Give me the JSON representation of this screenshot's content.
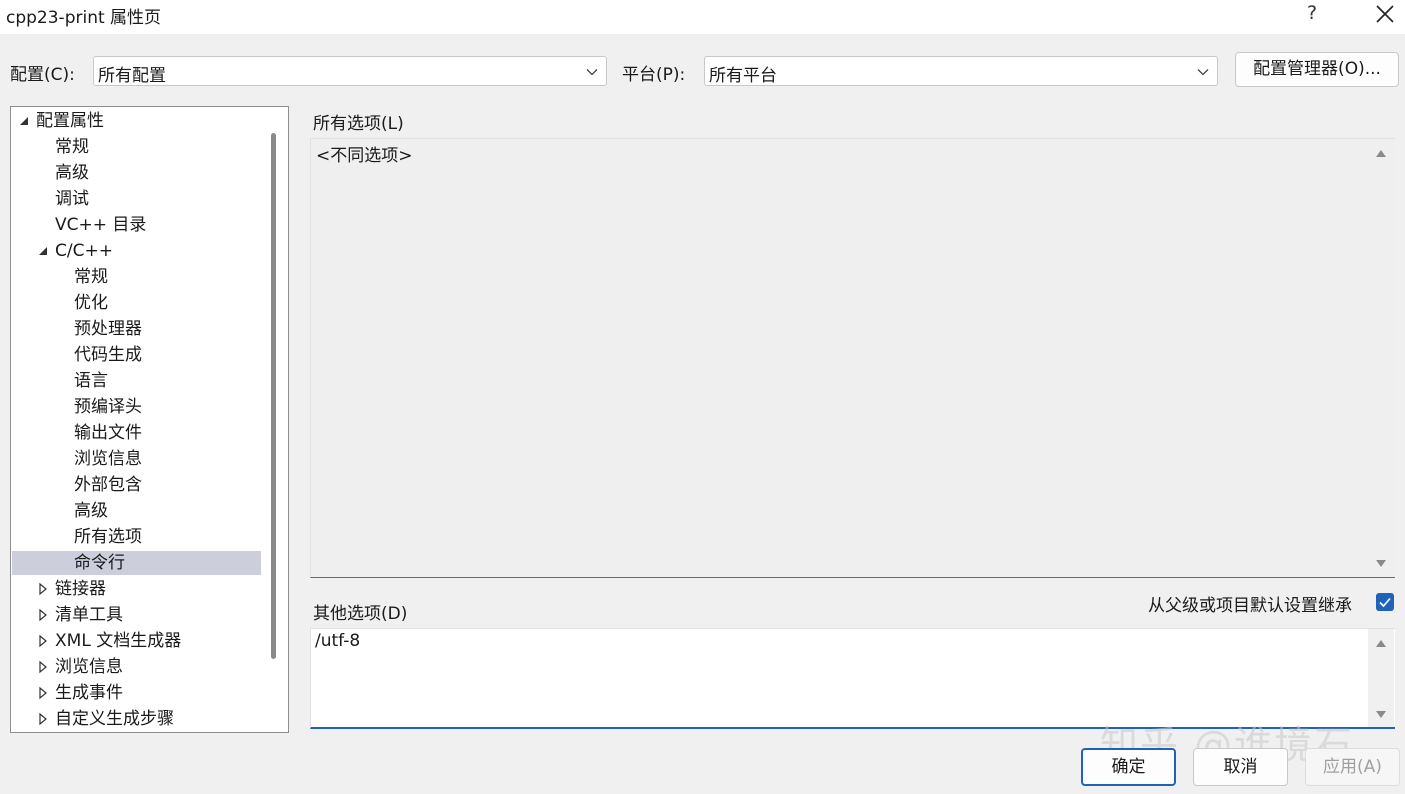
{
  "window": {
    "title": "cpp23-print 属性页",
    "help": "?"
  },
  "config_row": {
    "config_label": "配置(C):",
    "config_value": "所有配置",
    "platform_label": "平台(P):",
    "platform_value": "所有平台",
    "manager_button": "配置管理器(O)..."
  },
  "tree": [
    {
      "label": "配置属性",
      "level": 0,
      "expander": "expanded"
    },
    {
      "label": "常规",
      "level": 1,
      "expander": "none"
    },
    {
      "label": "高级",
      "level": 1,
      "expander": "none"
    },
    {
      "label": "调试",
      "level": 1,
      "expander": "none"
    },
    {
      "label": "VC++ 目录",
      "level": 1,
      "expander": "none"
    },
    {
      "label": "C/C++",
      "level": 1,
      "expander": "expanded"
    },
    {
      "label": "常规",
      "level": 2,
      "expander": "none"
    },
    {
      "label": "优化",
      "level": 2,
      "expander": "none"
    },
    {
      "label": "预处理器",
      "level": 2,
      "expander": "none"
    },
    {
      "label": "代码生成",
      "level": 2,
      "expander": "none"
    },
    {
      "label": "语言",
      "level": 2,
      "expander": "none"
    },
    {
      "label": "预编译头",
      "level": 2,
      "expander": "none"
    },
    {
      "label": "输出文件",
      "level": 2,
      "expander": "none"
    },
    {
      "label": "浏览信息",
      "level": 2,
      "expander": "none"
    },
    {
      "label": "外部包含",
      "level": 2,
      "expander": "none"
    },
    {
      "label": "高级",
      "level": 2,
      "expander": "none"
    },
    {
      "label": "所有选项",
      "level": 2,
      "expander": "none"
    },
    {
      "label": "命令行",
      "level": 2,
      "expander": "none",
      "selected": true
    },
    {
      "label": "链接器",
      "level": 1,
      "expander": "collapsed"
    },
    {
      "label": "清单工具",
      "level": 1,
      "expander": "collapsed"
    },
    {
      "label": "XML 文档生成器",
      "level": 1,
      "expander": "collapsed"
    },
    {
      "label": "浏览信息",
      "level": 1,
      "expander": "collapsed"
    },
    {
      "label": "生成事件",
      "level": 1,
      "expander": "collapsed"
    },
    {
      "label": "自定义生成步骤",
      "level": 1,
      "expander": "collapsed"
    }
  ],
  "all_options": {
    "label": "所有选项(L)",
    "value": "<不同选项>"
  },
  "other_options": {
    "label": "其他选项(D)",
    "value": "/utf-8",
    "inherit_label": "从父级或项目默认设置继承",
    "inherit_checked": true
  },
  "buttons": {
    "ok": "确定",
    "cancel": "取消",
    "apply": "应用(A)"
  },
  "watermark": "知乎 @谁境石",
  "colors": {
    "accent": "#1f63b8",
    "selection": "#cccedb"
  }
}
